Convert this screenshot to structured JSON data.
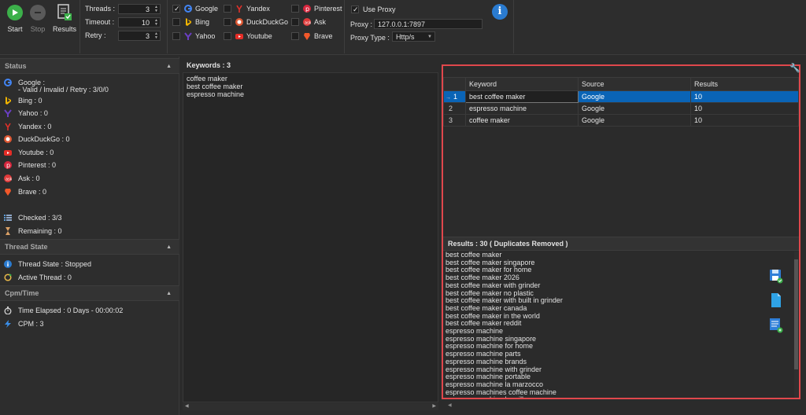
{
  "toolbar": {
    "start_label": "Start",
    "stop_label": "Stop",
    "results_label": "Results",
    "threads_label": "Threads :",
    "threads_value": "3",
    "timeout_label": "Timeout :",
    "timeout_value": "10",
    "retry_label": "Retry :",
    "retry_value": "3"
  },
  "engines": [
    {
      "name": "Google",
      "checked": true,
      "icon": "google-icon",
      "color": "#4285f4"
    },
    {
      "name": "Bing",
      "checked": false,
      "icon": "bing-icon",
      "color": "#f0b400"
    },
    {
      "name": "Yahoo",
      "checked": false,
      "icon": "yahoo-icon",
      "color": "#6a3fc2"
    },
    {
      "name": "Yandex",
      "checked": false,
      "icon": "yandex-icon",
      "color": "#e0302a"
    },
    {
      "name": "DuckDuckGo",
      "checked": false,
      "icon": "duckduckgo-icon",
      "color": "#de5833"
    },
    {
      "name": "Youtube",
      "checked": false,
      "icon": "youtube-icon",
      "color": "#e52d27"
    },
    {
      "name": "Pinterest",
      "checked": false,
      "icon": "pinterest-icon",
      "color": "#d7263d"
    },
    {
      "name": "Ask",
      "checked": false,
      "icon": "ask-icon",
      "color": "#e03a3a"
    },
    {
      "name": "Brave",
      "checked": false,
      "icon": "brave-icon",
      "color": "#f2582a"
    }
  ],
  "proxy": {
    "use_proxy_label": "Use Proxy",
    "use_proxy_checked": true,
    "proxy_label": "Proxy :",
    "proxy_value": "127.0.0.1:7897",
    "type_label": "Proxy Type :",
    "type_value": "Http/s"
  },
  "status": {
    "section_title": "Status",
    "google_line1": "Google :",
    "google_line2": "- Valid / Invalid / Retry : 3/0/0",
    "bing": "Bing : 0",
    "yahoo": "Yahoo : 0",
    "yandex": "Yandex : 0",
    "duckduckgo": "DuckDuckGo : 0",
    "youtube": "Youtube : 0",
    "pinterest": "Pinterest : 0",
    "ask": "Ask : 0",
    "brave": "Brave : 0",
    "checked": "Checked : 3/3",
    "remaining": "Remaining : 0"
  },
  "thread_state": {
    "section_title": "Thread State",
    "state": "Thread State : Stopped",
    "active": "Active Thread : 0"
  },
  "cpm_time": {
    "section_title": "Cpm/Time",
    "elapsed": "Time Elapsed : 0 Days - 00:00:02",
    "cpm": "CPM : 3"
  },
  "keywords": {
    "header": "Keywords : 3",
    "items": [
      "coffee maker",
      "best coffee maker",
      "espresso machine"
    ]
  },
  "results_table": {
    "columns": [
      "Keyword",
      "Source",
      "Results"
    ],
    "rows": [
      {
        "num": "1",
        "keyword": "best coffee maker",
        "source": "Google",
        "results": "10",
        "selected": true
      },
      {
        "num": "2",
        "keyword": "espresso machine",
        "source": "Google",
        "results": "10",
        "selected": false
      },
      {
        "num": "3",
        "keyword": "coffee maker",
        "source": "Google",
        "results": "10",
        "selected": false
      }
    ]
  },
  "results": {
    "header": "Results : 30 ( Duplicates Removed )",
    "items": [
      "best coffee maker",
      "best coffee maker singapore",
      "best coffee maker for home",
      "best coffee maker 2026",
      "best coffee maker with grinder",
      "best coffee maker no plastic",
      "best coffee maker with built in grinder",
      "best coffee maker canada",
      "best coffee maker in the world",
      "best coffee maker reddit",
      "espresso machine",
      "espresso machine singapore",
      "espresso machine for home",
      "espresso machine parts",
      "espresso machine brands",
      "espresso machine with grinder",
      "espresso machine portable",
      "espresso machine la marzocco",
      "espresso machines coffee machine",
      "espresso machine breville"
    ]
  },
  "colors": {
    "accent": "#0a64b6",
    "highlight_border": "#e0474c",
    "start": "#3cb04a",
    "info": "#2a7bd0"
  }
}
